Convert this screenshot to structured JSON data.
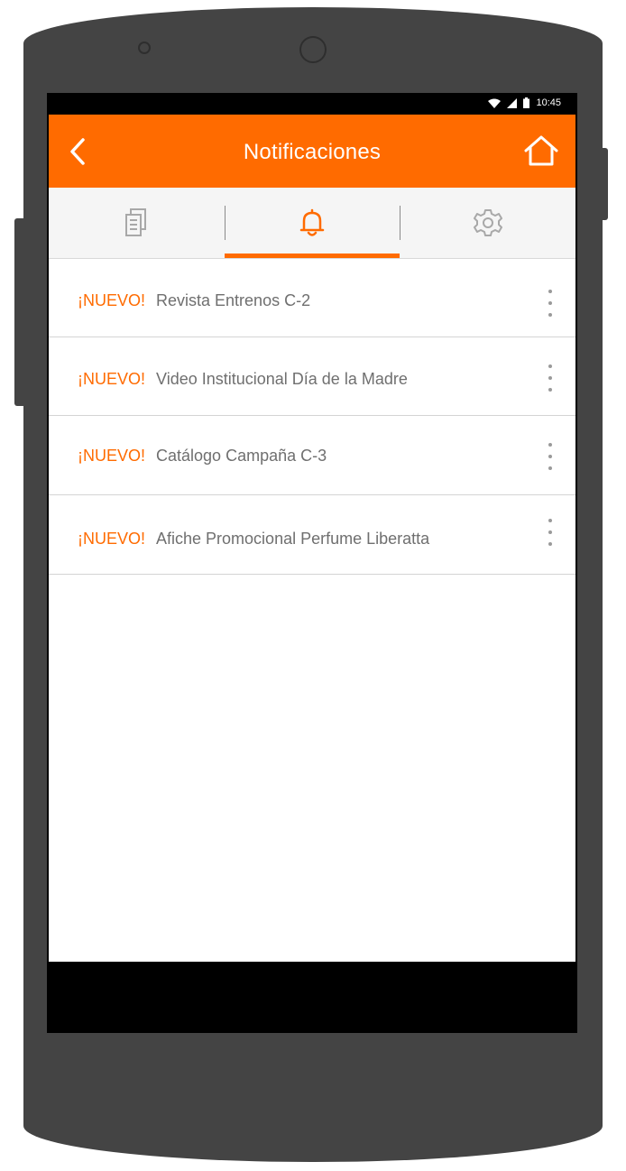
{
  "status_bar": {
    "time": "10:45",
    "icons": [
      "wifi-icon",
      "signal-icon",
      "battery-icon"
    ]
  },
  "app_bar": {
    "title": "Notificaciones",
    "back_icon": "chevron-left-icon",
    "home_icon": "home-icon",
    "color": "#ff6b00"
  },
  "tabs": [
    {
      "icon": "documents-icon",
      "active": false
    },
    {
      "icon": "bell-icon",
      "active": true
    },
    {
      "icon": "gear-icon",
      "active": false
    }
  ],
  "notifications": [
    {
      "badge": "¡NUEVO!",
      "title": "Revista Entrenos C-2"
    },
    {
      "badge": "¡NUEVO!",
      "title": "Video Institucional Día de la Madre"
    },
    {
      "badge": "¡NUEVO!",
      "title": "Catálogo Campaña C-3"
    },
    {
      "badge": "¡NUEVO!",
      "title": "Afiche Promocional Perfume Liberatta"
    }
  ],
  "colors": {
    "accent": "#ff6b00",
    "text_secondary": "#6f6f6f",
    "divider": "#d4d4d4",
    "device_body": "#444444"
  }
}
